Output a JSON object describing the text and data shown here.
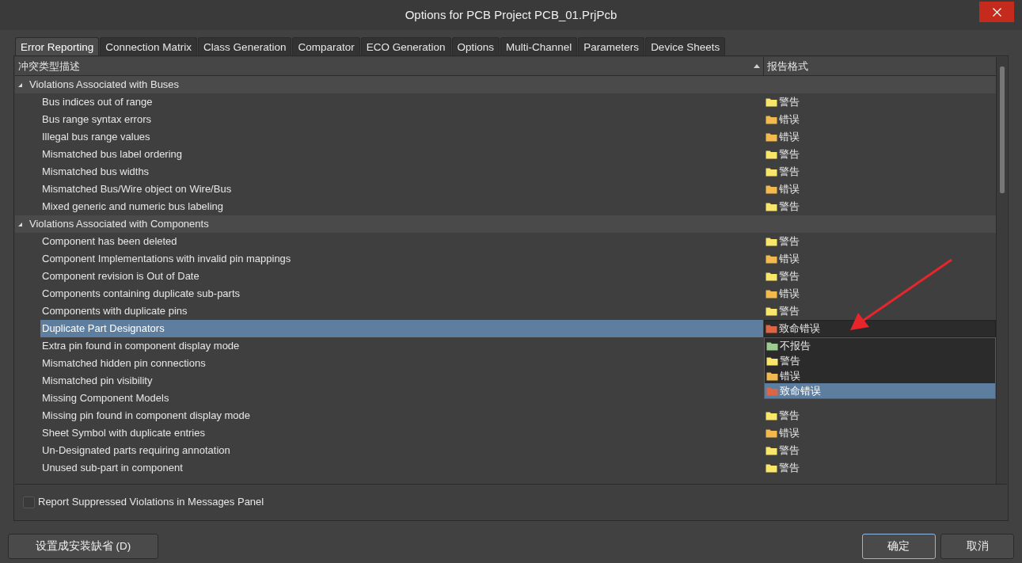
{
  "window": {
    "title": "Options for PCB Project PCB_01.PrjPcb"
  },
  "tabs": [
    {
      "label": "Error Reporting",
      "selected": true
    },
    {
      "label": "Connection Matrix",
      "selected": false
    },
    {
      "label": "Class Generation",
      "selected": false
    },
    {
      "label": "Comparator",
      "selected": false
    },
    {
      "label": "ECO Generation",
      "selected": false
    },
    {
      "label": "Options",
      "selected": false
    },
    {
      "label": "Multi-Channel",
      "selected": false
    },
    {
      "label": "Parameters",
      "selected": false
    },
    {
      "label": "Device Sheets",
      "selected": false
    }
  ],
  "table": {
    "columns": [
      "冲突类型描述",
      "报告格式"
    ],
    "groups": [
      {
        "label": "Violations Associated with Buses",
        "expanded": true,
        "rows": [
          {
            "label": "Bus indices out of range",
            "report": "警告",
            "color": "#f8e66a",
            "selected": false
          },
          {
            "label": "Bus range syntax errors",
            "report": "错误",
            "color": "#f2b94e",
            "selected": false
          },
          {
            "label": "Illegal bus range values",
            "report": "错误",
            "color": "#f2b94e",
            "selected": false
          },
          {
            "label": "Mismatched bus label ordering",
            "report": "警告",
            "color": "#f8e66a",
            "selected": false
          },
          {
            "label": "Mismatched bus widths",
            "report": "警告",
            "color": "#f8e66a",
            "selected": false
          },
          {
            "label": "Mismatched Bus/Wire object on Wire/Bus",
            "report": "错误",
            "color": "#f2b94e",
            "selected": false
          },
          {
            "label": "Mixed generic and numeric bus labeling",
            "report": "警告",
            "color": "#f8e66a",
            "selected": false
          }
        ]
      },
      {
        "label": "Violations Associated with Components",
        "expanded": true,
        "rows": [
          {
            "label": "Component has been deleted",
            "report": "警告",
            "color": "#f8e66a",
            "selected": false
          },
          {
            "label": "Component Implementations with invalid pin mappings",
            "report": "错误",
            "color": "#f2b94e",
            "selected": false
          },
          {
            "label": "Component revision is Out of Date",
            "report": "警告",
            "color": "#f8e66a",
            "selected": false
          },
          {
            "label": "Components containing duplicate sub-parts",
            "report": "错误",
            "color": "#f2b94e",
            "selected": false
          },
          {
            "label": "Components with duplicate pins",
            "report": "警告",
            "color": "#f8e66a",
            "selected": false
          },
          {
            "label": "Duplicate Part Designators",
            "report": "致命错误",
            "color": "#db6545",
            "selected": true
          },
          {
            "label": "Extra pin found in component display mode",
            "selected": false
          },
          {
            "label": "Mismatched hidden pin connections",
            "selected": false
          },
          {
            "label": "Mismatched pin visibility",
            "selected": false
          },
          {
            "label": "Missing Component Models",
            "selected": false
          },
          {
            "label": "Missing pin found in component display mode",
            "report": "警告",
            "color": "#f8e66a",
            "selected": false
          },
          {
            "label": "Sheet Symbol with duplicate entries",
            "report": "错误",
            "color": "#f2b94e",
            "selected": false
          },
          {
            "label": "Un-Designated parts requiring annotation",
            "report": "警告",
            "color": "#f8e66a",
            "selected": false
          },
          {
            "label": "Unused sub-part in component",
            "report": "警告",
            "color": "#f8e66a",
            "selected": false
          }
        ]
      }
    ],
    "dropdown": {
      "options": [
        {
          "label": "不报告",
          "color": "#9ccb90",
          "selected": false
        },
        {
          "label": "警告",
          "color": "#f8e66a",
          "selected": false
        },
        {
          "label": "错误",
          "color": "#f2b94e",
          "selected": false
        },
        {
          "label": "致命错误",
          "color": "#db6545",
          "selected": true
        }
      ]
    }
  },
  "checkbox": {
    "label": "Report Suppressed Violations in Messages Panel",
    "checked": false
  },
  "buttons": [
    {
      "label": "设置成安装缺省 (D)",
      "focused": false
    },
    {
      "label": "确定",
      "focused": true
    },
    {
      "label": "取消",
      "focused": false
    }
  ]
}
